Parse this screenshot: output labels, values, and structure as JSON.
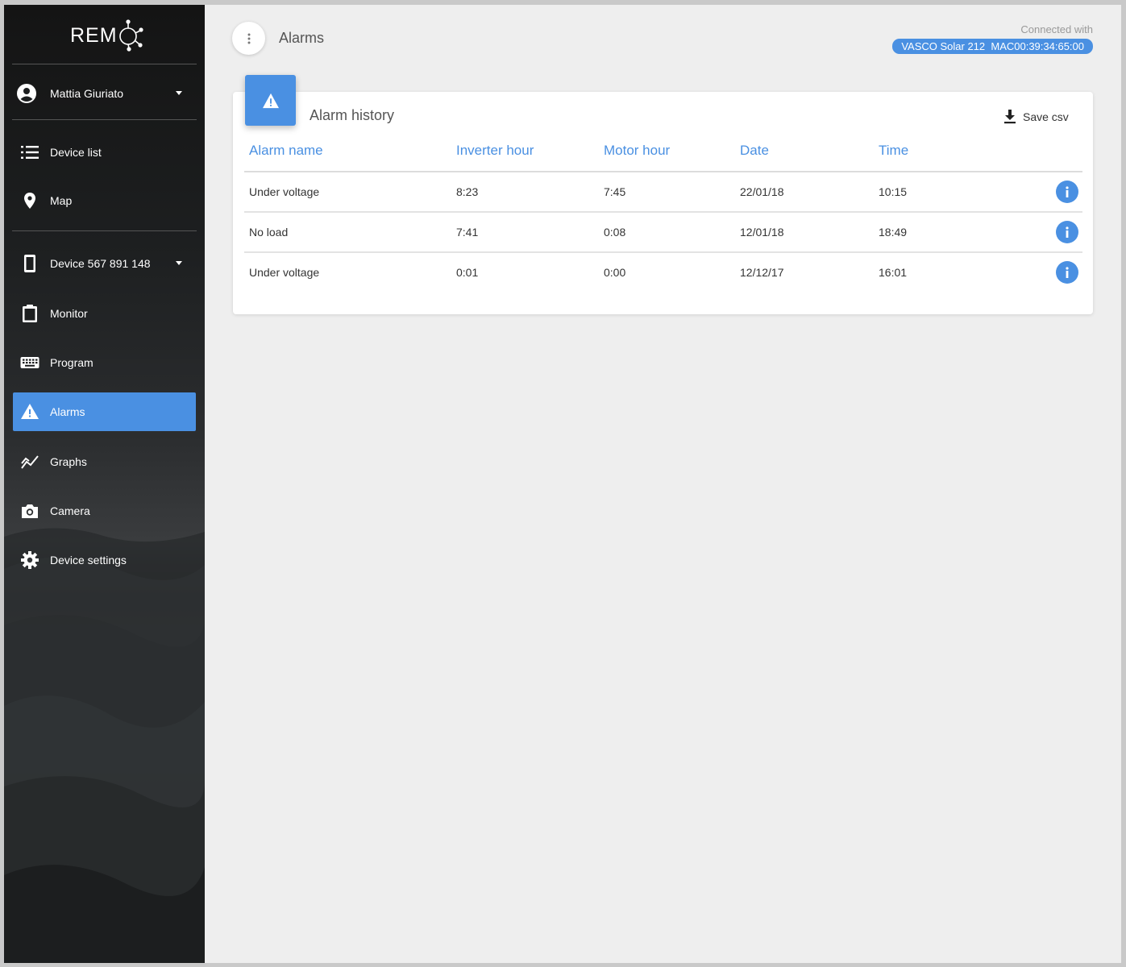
{
  "app": {
    "logo_text": "REM"
  },
  "sidebar": {
    "user": {
      "name": "Mattia Giuriato",
      "icon": "account-circle-icon"
    },
    "items_top": [
      {
        "label": "Device list",
        "icon": "list-icon"
      },
      {
        "label": "Map",
        "icon": "map-pin-icon"
      }
    ],
    "device": {
      "label": "Device 567 891 148",
      "icon": "phone-device-icon"
    },
    "items_device": [
      {
        "label": "Monitor",
        "icon": "clipboard-icon"
      },
      {
        "label": "Program",
        "icon": "keyboard-icon"
      },
      {
        "label": "Alarms",
        "icon": "warning-icon",
        "active": true
      },
      {
        "label": "Graphs",
        "icon": "chart-line-icon"
      },
      {
        "label": "Camera",
        "icon": "camera-icon"
      },
      {
        "label": "Device settings",
        "icon": "gear-icon"
      }
    ]
  },
  "header": {
    "title": "Alarms",
    "connected_label": "Connected with",
    "connected_device": "VASCO Solar 212  MAC00:39:34:65:00"
  },
  "alarm_history": {
    "title": "Alarm history",
    "save_label": "Save csv",
    "columns": [
      "Alarm name",
      "Inverter hour",
      "Motor hour",
      "Date",
      "Time"
    ],
    "rows": [
      [
        "Under voltage",
        "8:23",
        "7:45",
        "22/01/18",
        "10:15"
      ],
      [
        "No load",
        "7:41",
        "0:08",
        "12/01/18",
        "18:49"
      ],
      [
        "Under voltage",
        "0:01",
        "0:00",
        "12/12/17",
        "16:01"
      ]
    ]
  },
  "colors": {
    "accent": "#4a90e2",
    "background": "#eeeeee",
    "sidebar": "#1d1f20"
  }
}
